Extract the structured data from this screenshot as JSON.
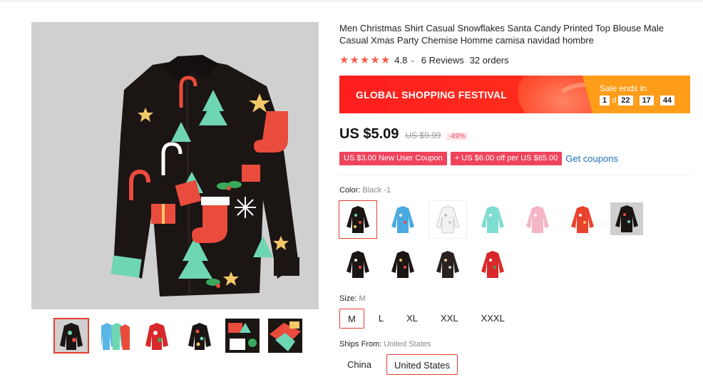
{
  "product": {
    "title": "Men Christmas Shirt Casual Snowflakes Santa Candy Printed Top Blouse Male Casual Xmas Party Chemise Homme camisa navidad hombre",
    "rating": "4.8",
    "reviews": "6 Reviews",
    "orders": "32 orders"
  },
  "banner": {
    "title": "GLOBAL SHOPPING FESTIVAL",
    "sale_label": "Sale ends in",
    "days": "1",
    "day_unit": "d",
    "hours": "22",
    "minutes": "17",
    "seconds": "44"
  },
  "price": {
    "current": "US $5.09",
    "original": "US $9.99",
    "discount": "-49%"
  },
  "coupons": {
    "new_user": "US $3.00 New User Coupon",
    "store": "+ US $6.00 off per US $65.00",
    "get_link": "Get coupons"
  },
  "color": {
    "label": "Color:",
    "selected": "Black -1",
    "swatches": [
      "black-1",
      "blue",
      "white",
      "mint",
      "pink",
      "red",
      "black-gray",
      "black-2",
      "black-3",
      "black-4",
      "red-2"
    ]
  },
  "size": {
    "label": "Size:",
    "selected": "M",
    "options": [
      "M",
      "L",
      "XL",
      "XXL",
      "XXXL"
    ]
  },
  "ships": {
    "label": "Ships From:",
    "selected": "United States",
    "options": [
      "China",
      "United States"
    ]
  },
  "colors": {
    "accent": "#e63c2f",
    "star": "#f55d4c",
    "coupon": "#f0435c",
    "link": "#1f6fb8",
    "banner_red": "#ff1e1e",
    "banner_orange": "#ff9c18"
  }
}
